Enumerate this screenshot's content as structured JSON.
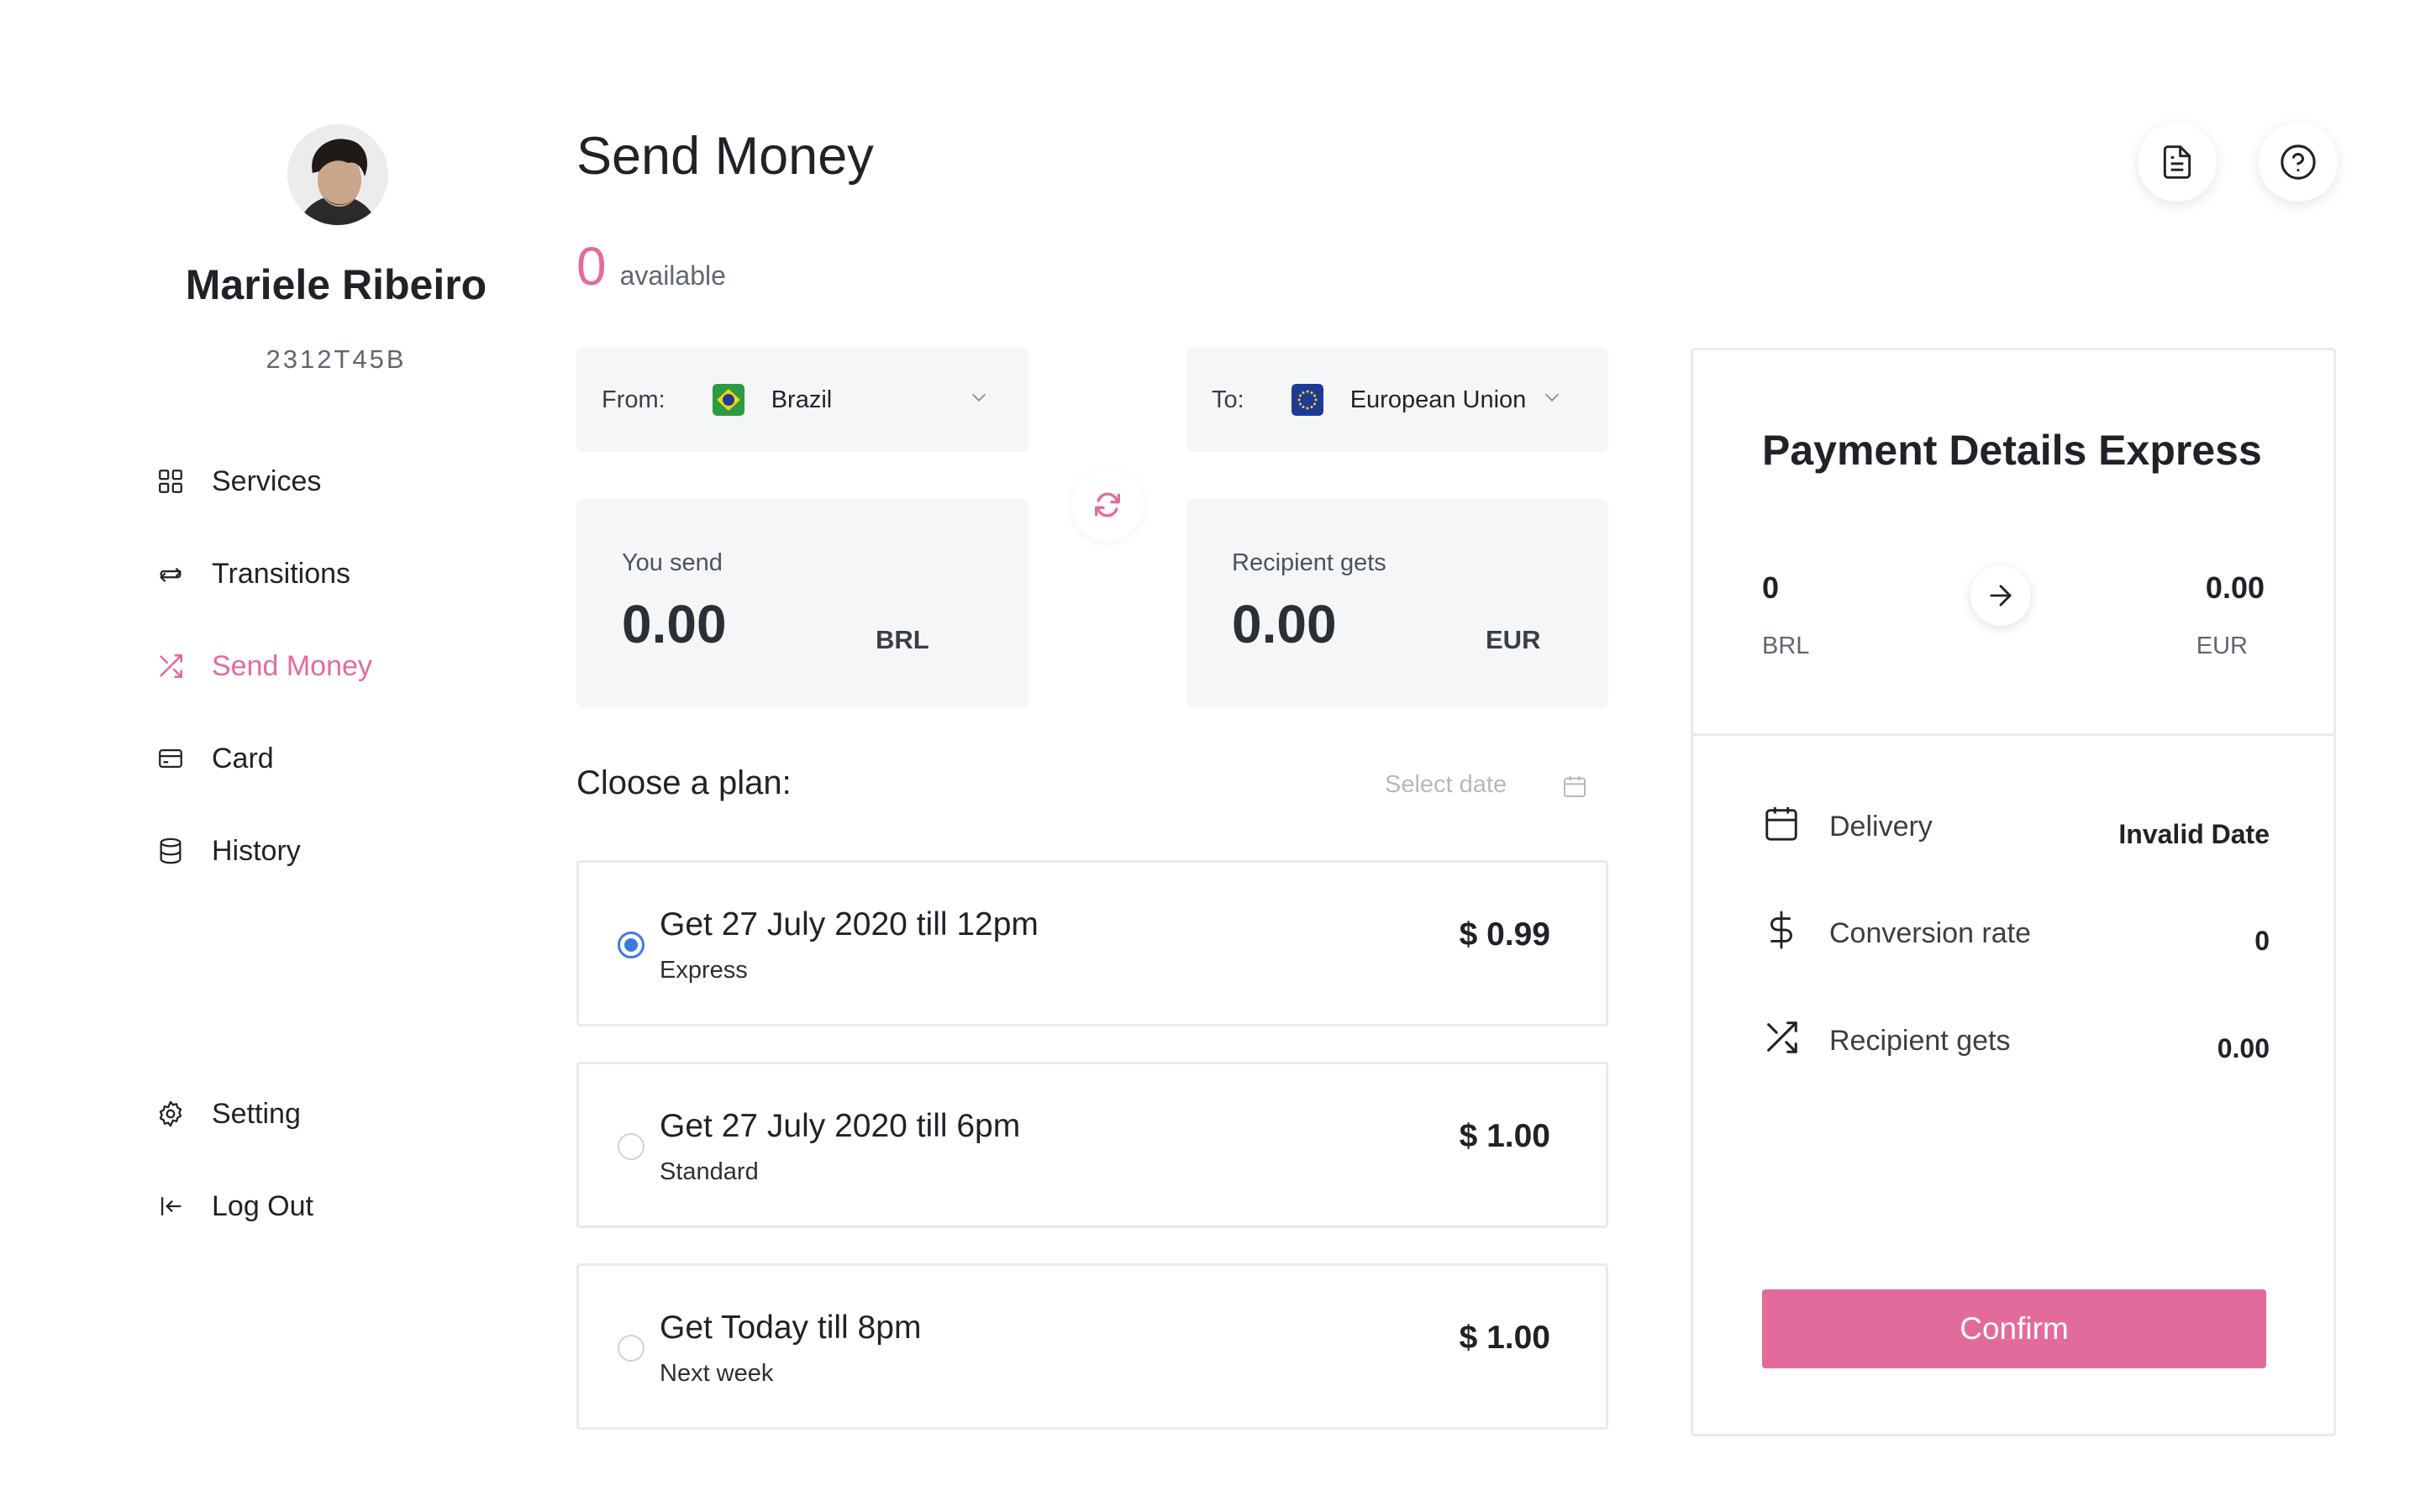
{
  "user": {
    "name": "Mariele Ribeiro",
    "id": "2312T45B"
  },
  "sidebar": {
    "items": [
      {
        "label": "Services",
        "icon": "grid-icon",
        "active": false
      },
      {
        "label": "Transitions",
        "icon": "repeat-icon",
        "active": false
      },
      {
        "label": "Send Money",
        "icon": "shuffle-icon",
        "active": true
      },
      {
        "label": "Card",
        "icon": "credit-card-icon",
        "active": false
      },
      {
        "label": "History",
        "icon": "database-icon",
        "active": false
      }
    ],
    "bottom_items": [
      {
        "label": "Setting",
        "icon": "gear-icon"
      },
      {
        "label": "Log Out",
        "icon": "logout-icon"
      }
    ]
  },
  "header": {
    "title": "Send Money",
    "balance_amount": "0",
    "balance_label": "available",
    "actions": [
      "document-icon",
      "help-icon"
    ]
  },
  "transfer": {
    "from_label": "From:",
    "from_country": "Brazil",
    "to_label": "To:",
    "to_country": "European Union",
    "you_send_label": "You send",
    "you_send_amount": "0.00",
    "you_send_currency": "BRL",
    "recipient_label": "Recipient gets",
    "recipient_amount": "0.00",
    "recipient_currency": "EUR"
  },
  "plans": {
    "title": "Cloose a plan:",
    "select_date_placeholder": "Select date",
    "options": [
      {
        "title": "Get 27 July 2020 till 12pm",
        "subtitle": "Express",
        "price": "$ 0.99",
        "selected": true
      },
      {
        "title": "Get 27 July 2020 till 6pm",
        "subtitle": "Standard",
        "price": "$ 1.00",
        "selected": false
      },
      {
        "title": "Get Today till 8pm",
        "subtitle": "Next week",
        "price": "$ 1.00",
        "selected": false
      }
    ]
  },
  "payment_details": {
    "title": "Payment Details Express",
    "from_amount": "0",
    "from_currency": "BRL",
    "to_amount": "0.00",
    "to_currency": "EUR",
    "rows": [
      {
        "label": "Delivery",
        "value": "Invalid Date",
        "icon": "calendar-icon"
      },
      {
        "label": "Conversion rate",
        "value": "0",
        "icon": "dollar-icon"
      },
      {
        "label": "Recipient gets",
        "value": "0.00",
        "icon": "shuffle-icon"
      }
    ],
    "confirm_label": "Confirm"
  },
  "colors": {
    "accent": "#e36b9c",
    "radio_selected": "#3b7be0",
    "panel_bg": "#f5f6f8",
    "border": "#e8eaed"
  }
}
